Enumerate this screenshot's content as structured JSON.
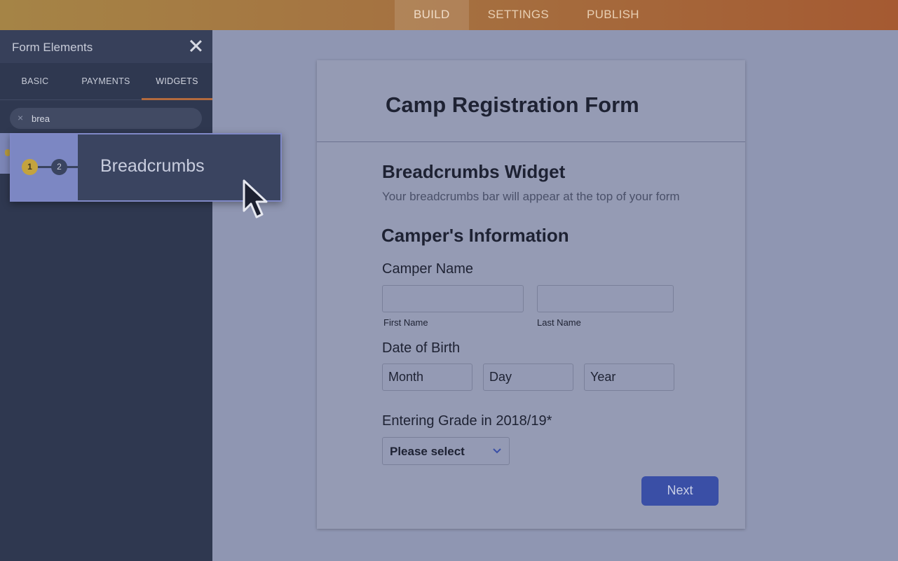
{
  "topbar": {
    "tabs": [
      {
        "label": "BUILD",
        "active": true
      },
      {
        "label": "SETTINGS",
        "active": false
      },
      {
        "label": "PUBLISH",
        "active": false
      }
    ]
  },
  "panel": {
    "title": "Form Elements",
    "tabs": [
      {
        "label": "BASIC"
      },
      {
        "label": "PAYMENTS"
      },
      {
        "label": "WIDGETS",
        "active": true
      }
    ],
    "search": {
      "value": "brea",
      "clear": "×"
    },
    "drag_item": {
      "label": "Breadcrumbs",
      "step1": "1",
      "step2": "2"
    }
  },
  "form": {
    "title": "Camp Registration Form",
    "widget_title": "Breadcrumbs Widget",
    "widget_subtitle": "Your breadcrumbs bar will appear at the top of your form",
    "section_title": "Camper's Information",
    "camper_name_label": "Camper Name",
    "first_name_label": "First Name",
    "last_name_label": "Last Name",
    "dob_label": "Date of Birth",
    "dob_month": "Month",
    "dob_day": "Day",
    "dob_year": "Year",
    "grade_label": "Entering Grade in 2018/19*",
    "grade_select": "Please select",
    "next_button": "Next"
  },
  "colors": {
    "accent": "#3a4fa6",
    "topbar": "#a57040",
    "panel": "#2f3850",
    "highlight": "#c4a33e"
  },
  "icons": {
    "close": "close-icon",
    "search_clear": "clear-search-icon",
    "chevron": "chevron-down-icon",
    "cursor": "mouse-pointer-icon"
  }
}
